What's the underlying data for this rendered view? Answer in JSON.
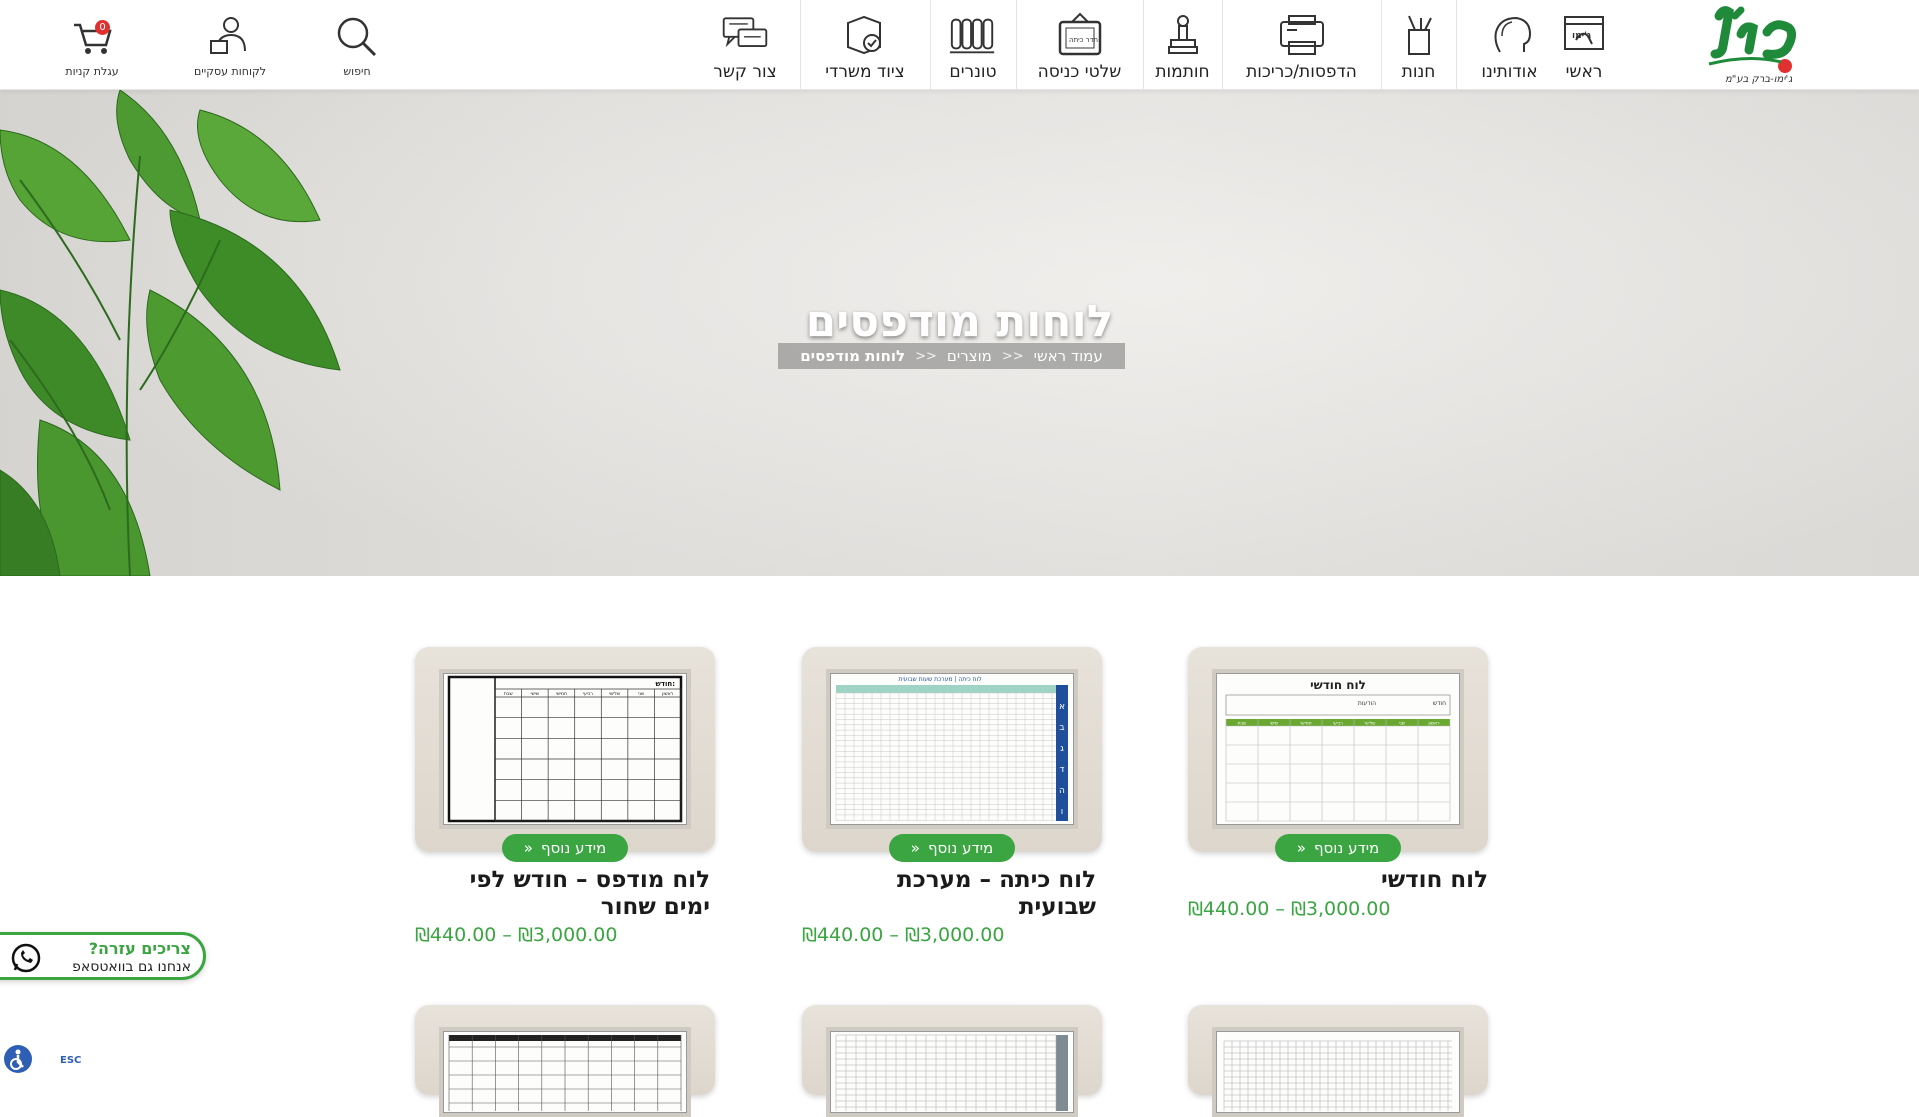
{
  "header": {
    "logo_text": "ג'ימו",
    "logo_tagline": "ג'ימו-ברק בע\"מ",
    "nav": [
      {
        "label": "ראשי",
        "icon": "home-screen-icon"
      },
      {
        "label": "אודותינו",
        "icon": "profile-head-icon"
      },
      {
        "label": "חנות",
        "icon": "pencil-cup-icon"
      },
      {
        "label": "הדפסות/כריכות",
        "icon": "printer-icon"
      },
      {
        "label": "חותמות",
        "icon": "stamp-icon"
      },
      {
        "label": "שלטי כניסה",
        "icon": "door-sign-icon"
      },
      {
        "label": "טונרים",
        "icon": "toner-icon"
      },
      {
        "label": "ציוד משרדי",
        "icon": "office-box-icon"
      },
      {
        "label": "צור קשר",
        "icon": "chat-bubbles-icon"
      }
    ],
    "door_sign_text": "חדר כיתה",
    "utilities": {
      "search_label": "חיפוש",
      "business_label": "לקוחות עסקיים",
      "cart_label": "עגלת קניות",
      "cart_count": "0"
    }
  },
  "hero": {
    "title": "לוחות מודפסים",
    "breadcrumb": [
      "עמוד ראשי",
      "מוצרים",
      "לוחות מודפסים"
    ],
    "breadcrumb_separator": ">>"
  },
  "products": [
    {
      "title_line1": "לוח חודשי",
      "title_line2": "",
      "price": "₪440.00 – ₪3,000.00",
      "button": "מידע נוסף",
      "board_title": "לוח חודשי",
      "board_style": "monthly-green"
    },
    {
      "title_line1": "לוח כיתה – מערכת",
      "title_line2": "שבועית",
      "price": "₪440.00 – ₪3,000.00",
      "button": "מידע נוסף",
      "board_title": "לוח כיתה | מערכת שעות שבועית",
      "board_style": "class-blue"
    },
    {
      "title_line1": "לוח מודפס – חודש לפי",
      "title_line2": "ימים שחור",
      "price": "₪440.00 – ₪3,000.00",
      "button": "מידע נוסף",
      "board_title": "חודש:",
      "board_style": "month-black"
    }
  ],
  "weekdays": [
    "ראשון",
    "שני",
    "שלישי",
    "רביעי",
    "חמישי",
    "שישי",
    "שבת"
  ],
  "board_labels": {
    "month": "חודש",
    "notes": "הודעות"
  },
  "class_rows": [
    "א",
    "ב",
    "ג",
    "ד",
    "ה",
    "ו"
  ],
  "whatsapp": {
    "title": "צריכים עזרה?",
    "subtitle": "אנחנו גם בוואטסאפ"
  },
  "accessibility": {
    "esc_label": "ESC"
  },
  "colors": {
    "accent_green": "#3aa541",
    "logo_red": "#e03030",
    "logo_green": "#1f8a3a"
  }
}
